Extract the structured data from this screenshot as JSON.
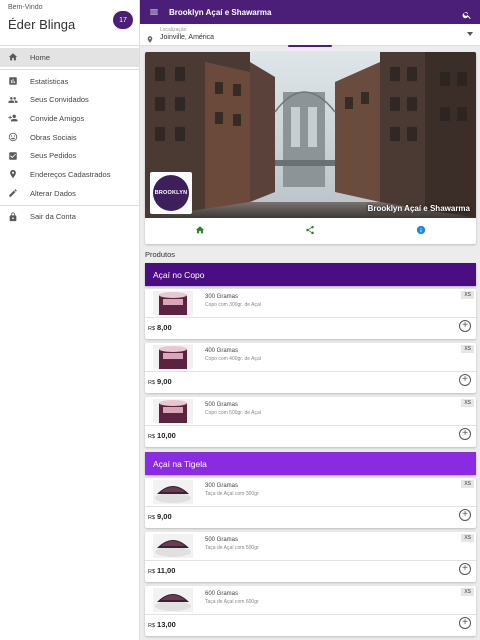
{
  "sidebar": {
    "welcome": "Bem-Vindo",
    "username": "Éder Blinga",
    "badge": "17",
    "items": [
      {
        "label": "Home",
        "icon": "home-icon",
        "active": true
      },
      {
        "label": "Estatísticas",
        "icon": "chart-icon"
      },
      {
        "label": "Seus Convidados",
        "icon": "people-icon"
      },
      {
        "label": "Convide Amigos",
        "icon": "person-add-icon"
      },
      {
        "label": "Obras Sociais",
        "icon": "smile-icon"
      },
      {
        "label": "Seus Pedidos",
        "icon": "checkbox-icon"
      },
      {
        "label": "Endereços Cadastrados",
        "icon": "location-pin-icon"
      },
      {
        "label": "Alterar Dados",
        "icon": "edit-icon"
      },
      {
        "label": "Sair da Conta",
        "icon": "lock-icon"
      }
    ]
  },
  "topbar": {
    "title": "Brooklyn Açaí e Shawarma"
  },
  "location": {
    "label": "Localização",
    "value": "Joinville, América"
  },
  "store": {
    "name": "Brooklyn Açaí e Shawarma",
    "logo_text": "BROOKLYN"
  },
  "products_label": "Produtos",
  "categories": [
    {
      "name": "Açaí no Copo",
      "color": "#4b0d82",
      "items": [
        {
          "name": "300 Gramas",
          "desc": "Copo com 300gr. de Açaí",
          "size": "XS",
          "currency": "R$",
          "price": "8,00"
        },
        {
          "name": "400 Gramas",
          "desc": "Copo com 400gr. de Açaí",
          "size": "XS",
          "currency": "R$",
          "price": "9,00"
        },
        {
          "name": "500 Gramas",
          "desc": "Copo com 500gr. de Açaí",
          "size": "XS",
          "currency": "R$",
          "price": "10,00"
        }
      ]
    },
    {
      "name": "Açaí na Tigela",
      "color": "#8a2be2",
      "items": [
        {
          "name": "300 Gramas",
          "desc": "Taça de Açaí com 300gr",
          "size": "XS",
          "currency": "R$",
          "price": "9,00"
        },
        {
          "name": "500 Gramas",
          "desc": "Taça de Açaí com 500gr",
          "size": "XS",
          "currency": "R$",
          "price": "11,00"
        },
        {
          "name": "600 Gramas",
          "desc": "Taça de Açaí com 600gr",
          "size": "XS",
          "currency": "R$",
          "price": "13,00"
        }
      ]
    }
  ],
  "colors": {
    "primary": "#4b1f78",
    "home_icon": "#2e7d32",
    "share_icon": "#2e7d32",
    "info_icon": "#1e88e5"
  }
}
